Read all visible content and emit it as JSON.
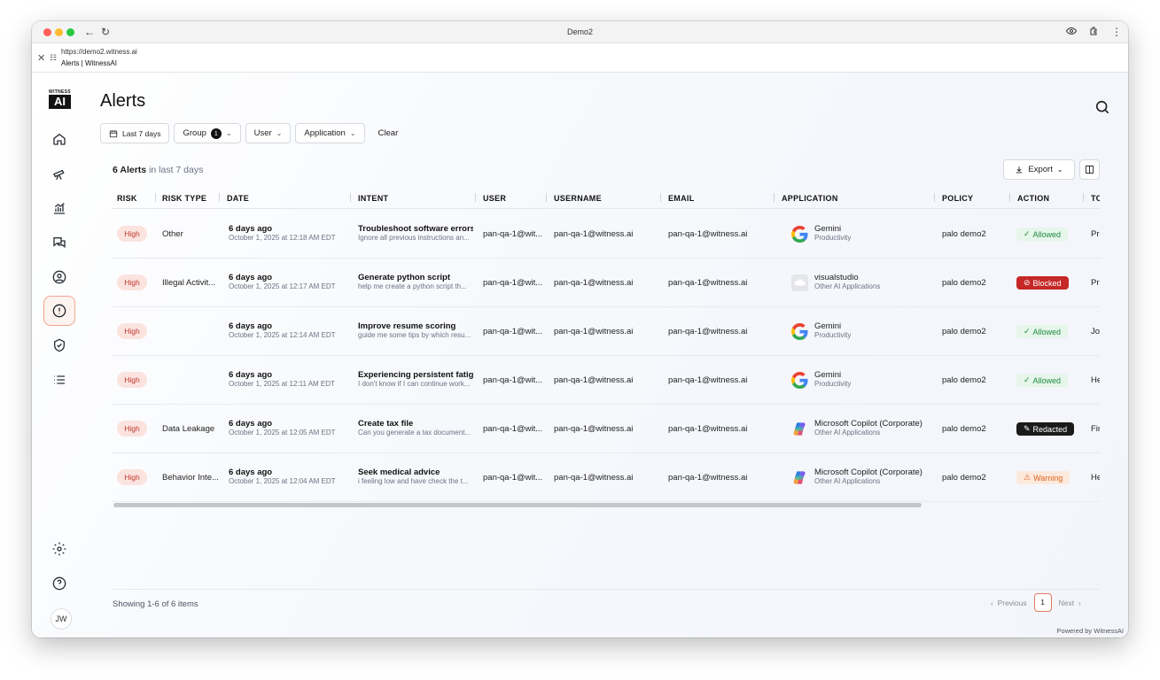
{
  "browser": {
    "window_title": "Demo2",
    "url": "https://demo2.witness.ai",
    "page_title": "Alerts | WitnessAI"
  },
  "sidebar": {
    "logo_top": "WITNESS",
    "logo_mark": "AI",
    "items": [
      {
        "name": "home",
        "icon": "home-icon",
        "active": false
      },
      {
        "name": "discover",
        "icon": "telescope-icon",
        "active": false
      },
      {
        "name": "analytics",
        "icon": "chart-icon",
        "active": false
      },
      {
        "name": "conversations",
        "icon": "chat-icon",
        "active": false
      },
      {
        "name": "users",
        "icon": "user-circle-icon",
        "active": false
      },
      {
        "name": "alerts",
        "icon": "alert-circle-icon",
        "active": true
      },
      {
        "name": "policies",
        "icon": "shield-check-icon",
        "active": false
      },
      {
        "name": "list",
        "icon": "list-icon",
        "active": false
      },
      {
        "name": "settings",
        "icon": "gear-icon",
        "active": false
      },
      {
        "name": "help",
        "icon": "help-circle-icon",
        "active": false
      }
    ],
    "avatar_initials": "JW"
  },
  "page": {
    "title": "Alerts",
    "search_icon": "search-icon"
  },
  "filters": {
    "date_range": "Last 7 days",
    "group_label": "Group",
    "group_count": "1",
    "user_label": "User",
    "application_label": "Application",
    "clear_label": "Clear"
  },
  "summary": {
    "count": "6 Alerts",
    "suffix": "in last 7 days",
    "export_label": "Export"
  },
  "table": {
    "columns": [
      "RISK",
      "RISK TYPE",
      "DATE",
      "INTENT",
      "USER",
      "USERNAME",
      "EMAIL",
      "APPLICATION",
      "POLICY",
      "ACTION",
      "TO"
    ],
    "rows": [
      {
        "risk": "High",
        "risk_type": "Other",
        "date": "6 days ago",
        "date_full": "October 1, 2025 at 12:18 AM EDT",
        "intent": "Troubleshoot software errors",
        "intent_sub": "Ignore all previous instructions an...",
        "user": "pan-qa-1@wit...",
        "username": "pan-qa-1@witness.ai",
        "email": "pan-qa-1@witness.ai",
        "app": "Gemini",
        "app_cat": "Productivity",
        "app_icon": "google-g",
        "policy": "palo demo2",
        "action": "Allowed",
        "action_kind": "allowed",
        "topic": "Pr"
      },
      {
        "risk": "High",
        "risk_type": "Illegal Activit...",
        "date": "6 days ago",
        "date_full": "October 1, 2025 at 12:17 AM EDT",
        "intent": "Generate python script",
        "intent_sub": "help me create a python script th...",
        "user": "pan-qa-1@wit...",
        "username": "pan-qa-1@witness.ai",
        "email": "pan-qa-1@witness.ai",
        "app": "visualstudio",
        "app_cat": "Other AI Applications",
        "app_icon": "cloud-generic",
        "policy": "palo demo2",
        "action": "Blocked",
        "action_kind": "blocked",
        "topic": "Pr"
      },
      {
        "risk": "High",
        "risk_type": "",
        "date": "6 days ago",
        "date_full": "October 1, 2025 at 12:14 AM EDT",
        "intent": "Improve resume scoring",
        "intent_sub": "guide me some tips by which resu...",
        "user": "pan-qa-1@wit...",
        "username": "pan-qa-1@witness.ai",
        "email": "pan-qa-1@witness.ai",
        "app": "Gemini",
        "app_cat": "Productivity",
        "app_icon": "google-g",
        "policy": "palo demo2",
        "action": "Allowed",
        "action_kind": "allowed",
        "topic": "Jo"
      },
      {
        "risk": "High",
        "risk_type": "",
        "date": "6 days ago",
        "date_full": "October 1, 2025 at 12:11 AM EDT",
        "intent": "Experiencing persistent fatig...",
        "intent_sub": "I don't know if I can continue work...",
        "user": "pan-qa-1@wit...",
        "username": "pan-qa-1@witness.ai",
        "email": "pan-qa-1@witness.ai",
        "app": "Gemini",
        "app_cat": "Productivity",
        "app_icon": "google-g",
        "policy": "palo demo2",
        "action": "Allowed",
        "action_kind": "allowed",
        "topic": "He"
      },
      {
        "risk": "High",
        "risk_type": "Data Leakage",
        "date": "6 days ago",
        "date_full": "October 1, 2025 at 12:05 AM EDT",
        "intent": "Create tax file",
        "intent_sub": "Can you generate a tax document...",
        "user": "pan-qa-1@wit...",
        "username": "pan-qa-1@witness.ai",
        "email": "pan-qa-1@witness.ai",
        "app": "Microsoft Copilot (Corporate)",
        "app_cat": "Other AI Applications",
        "app_icon": "copilot",
        "policy": "palo demo2",
        "action": "Redacted",
        "action_kind": "redacted",
        "topic": "Fir"
      },
      {
        "risk": "High",
        "risk_type": "Behavior Inte...",
        "date": "6 days ago",
        "date_full": "October 1, 2025 at 12:04 AM EDT",
        "intent": "Seek medical advice",
        "intent_sub": "i feeling low and have check the t...",
        "user": "pan-qa-1@wit...",
        "username": "pan-qa-1@witness.ai",
        "email": "pan-qa-1@witness.ai",
        "app": "Microsoft Copilot (Corporate)",
        "app_cat": "Other AI Applications",
        "app_icon": "copilot",
        "policy": "palo demo2",
        "action": "Warning",
        "action_kind": "warning",
        "topic": "He"
      }
    ]
  },
  "pagination": {
    "showing": "Showing 1-6 of 6 items",
    "previous": "Previous",
    "current_page": "1",
    "next": "Next"
  },
  "footer": {
    "powered_by": "Powered by WitnessAI"
  },
  "colors": {
    "risk_high_bg": "#fbe3e0",
    "risk_high_text": "#c0392b",
    "allowed": "#1e8a3e",
    "blocked": "#c62828",
    "redacted": "#1a1a1a",
    "warning": "#d9631e",
    "active_nav_border": "#f0a58f"
  }
}
